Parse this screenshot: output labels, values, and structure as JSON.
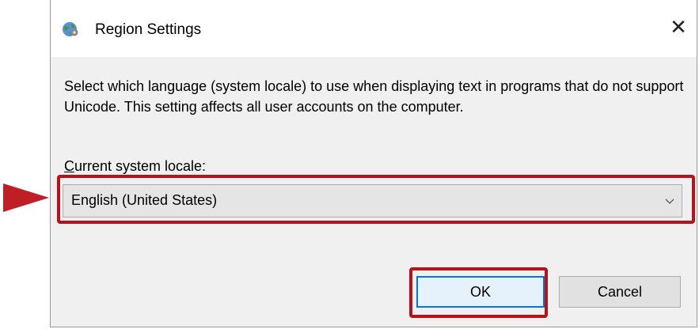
{
  "window": {
    "title": "Region Settings",
    "close_symbol": "✕",
    "icon": "globe-settings-icon"
  },
  "description": "Select which language (system locale) to use when displaying text in programs that do not support Unicode. This setting affects all user accounts on the computer.",
  "locale": {
    "label_accel": "C",
    "label_rest": "urrent system locale:",
    "selected": "English (United States)",
    "arrow_icon": "chevron-down-icon"
  },
  "buttons": {
    "ok": "OK",
    "cancel": "Cancel"
  },
  "colors": {
    "highlight": "#b5121b",
    "pointer": "#c01e26",
    "ok_border": "#0078d7",
    "dialog_bg": "#f0f0f0"
  }
}
